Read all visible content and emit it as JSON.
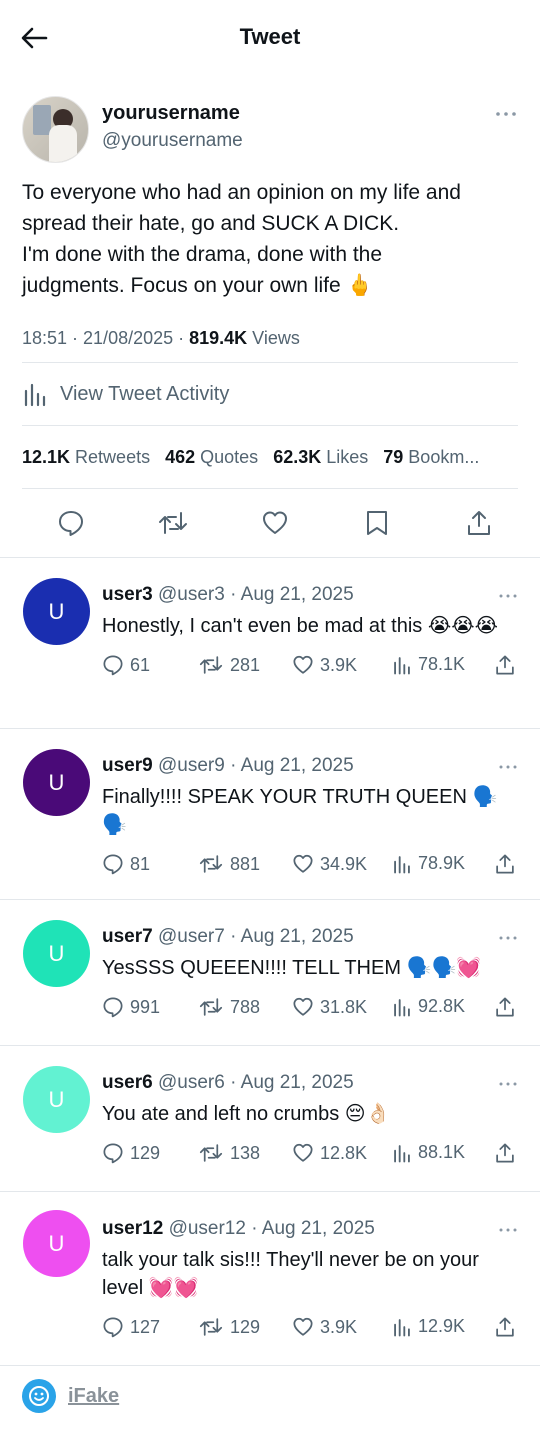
{
  "header": {
    "title": "Tweet"
  },
  "tweet": {
    "name": "yourusername",
    "handle": "@yourusername",
    "text_lines": [
      "To everyone who had an opinion on my life and",
      "spread their hate, go and SUCK A DICK.",
      "I'm done with the drama, done with the",
      "judgments. Focus on your own life 🖕"
    ],
    "time": "18:51 · 21/08/2025 · ",
    "views_count": "819.4K",
    "views_label": " Views",
    "activity_label": "View Tweet Activity",
    "stats": [
      {
        "count": "12.1K",
        "label": " Retweets"
      },
      {
        "count": "462",
        "label": " Quotes"
      },
      {
        "count": "62.3K",
        "label": " Likes"
      },
      {
        "count": "79",
        "label": " Bookm..."
      }
    ]
  },
  "replies": [
    {
      "initial": "U",
      "color": "#1a2eb0",
      "name": "user3",
      "handle": "@user3",
      "date": " · Aug 21, 2025",
      "text": "Honestly, I can't even be mad at this 😭😭😭",
      "replies": "61",
      "retweets": "281",
      "likes": "3.9K",
      "views": "78.1K"
    },
    {
      "initial": "U",
      "color": "#4a0a78",
      "name": "user9",
      "handle": "@user9",
      "date": " · Aug 21, 2025",
      "text": "Finally!!!! SPEAK YOUR TRUTH QUEEN 🗣️🗣️",
      "replies": "81",
      "retweets": "881",
      "likes": "34.9K",
      "views": "78.9K"
    },
    {
      "initial": "U",
      "color": "#1fe3b7",
      "name": "user7",
      "handle": "@user7",
      "date": " · Aug 21, 2025",
      "text": "YesSSS QUEEEN!!!! TELL THEM 🗣️🗣️💓",
      "replies": "991",
      "retweets": "788",
      "likes": "31.8K",
      "views": "92.8K"
    },
    {
      "initial": "U",
      "color": "#62f2d2",
      "name": "user6",
      "handle": "@user6",
      "date": " · Aug 21, 2025",
      "text": "You ate and left no crumbs 😔👌🏻",
      "replies": "129",
      "retweets": "138",
      "likes": "12.8K",
      "views": "88.1K"
    },
    {
      "initial": "U",
      "color": "#ee4ff0",
      "name": "user12",
      "handle": "@user12",
      "date": " · Aug 21, 2025",
      "text": "talk your talk sis!!! They'll never be on your level 💓💓",
      "replies": "127",
      "retweets": "129",
      "likes": "3.9K",
      "views": "12.9K"
    }
  ],
  "footer": {
    "label": "iFake"
  },
  "colors": {
    "text": "#0f1419",
    "secondary": "#536471",
    "divider": "#e3e7eb",
    "footer_logo": "#2aa3e8"
  }
}
